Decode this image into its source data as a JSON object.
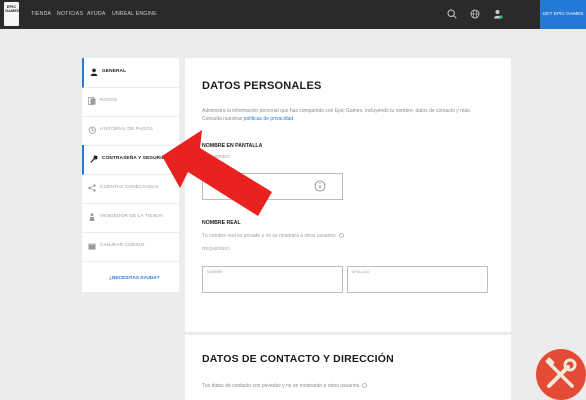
{
  "topbar": {
    "logo_text": "EPIC\nGAMES",
    "nav": [
      "TIENDA",
      "NOTICIAS",
      "AYUDA",
      "UNREAL ENGINE"
    ],
    "get_button": "GET EPIC GAMES"
  },
  "sidebar": {
    "items": [
      {
        "label": "GENERAL",
        "icon": "user-icon"
      },
      {
        "label": "PAGOS",
        "icon": "card-icon"
      },
      {
        "label": "HISTORIAL DE PAGOS",
        "icon": "history-icon"
      },
      {
        "label": "CONTRASEÑA Y SEGURIDAD",
        "icon": "key-icon"
      },
      {
        "label": "CUENTAS CONECTADAS",
        "icon": "share-icon"
      },
      {
        "label": "VENDEDOR DE LA TIENDA",
        "icon": "person-icon"
      },
      {
        "label": "CANJEAR CÓDIGO",
        "icon": "gift-icon"
      }
    ],
    "help": "¿NECESITAS AYUDA?"
  },
  "personal": {
    "title": "DATOS PERSONALES",
    "desc_line1": "Administra la información personal que has compartido con Epic Games, incluyendo tu nombre, datos de contacto y más.",
    "desc_line2_prefix": "Consulta nuestras ",
    "desc_link": "políticas de privacidad",
    "display_name_label": "NOMBRE EN PANTALLA",
    "required": "REQUERIDO",
    "real_name_label": "NOMBRE REAL",
    "real_name_desc": "Tu nombre real es privado y no se mostrará a otros usuarios.",
    "first_name_placeholder": "NOMBRE",
    "last_name_placeholder": "APELLIDO"
  },
  "contact": {
    "title": "DATOS DE CONTACTO Y DIRECCIÓN",
    "desc": "Tus datos de contacto son privados y no se mostrarán a otros usuarios."
  },
  "colors": {
    "accent": "#2479d7",
    "arrow": "#e8231f",
    "topbar": "#2a2a2a",
    "badge": "#e44b34",
    "badge_tools": "#f0e8d8"
  }
}
